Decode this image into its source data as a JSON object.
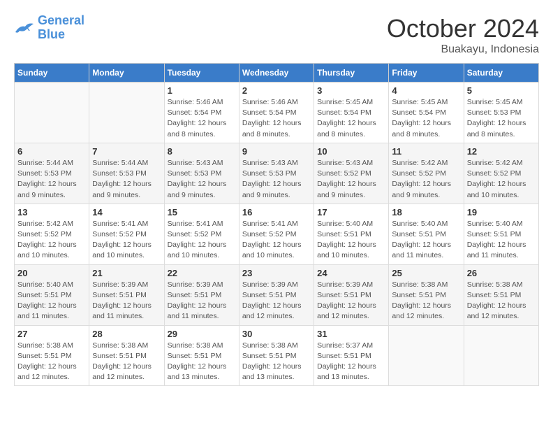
{
  "header": {
    "logo_line1": "General",
    "logo_line2": "Blue",
    "month_year": "October 2024",
    "location": "Buakayu, Indonesia"
  },
  "weekdays": [
    "Sunday",
    "Monday",
    "Tuesday",
    "Wednesday",
    "Thursday",
    "Friday",
    "Saturday"
  ],
  "weeks": [
    [
      {
        "day": "",
        "info": ""
      },
      {
        "day": "",
        "info": ""
      },
      {
        "day": "1",
        "info": "Sunrise: 5:46 AM\nSunset: 5:54 PM\nDaylight: 12 hours and 8 minutes."
      },
      {
        "day": "2",
        "info": "Sunrise: 5:46 AM\nSunset: 5:54 PM\nDaylight: 12 hours and 8 minutes."
      },
      {
        "day": "3",
        "info": "Sunrise: 5:45 AM\nSunset: 5:54 PM\nDaylight: 12 hours and 8 minutes."
      },
      {
        "day": "4",
        "info": "Sunrise: 5:45 AM\nSunset: 5:54 PM\nDaylight: 12 hours and 8 minutes."
      },
      {
        "day": "5",
        "info": "Sunrise: 5:45 AM\nSunset: 5:53 PM\nDaylight: 12 hours and 8 minutes."
      }
    ],
    [
      {
        "day": "6",
        "info": "Sunrise: 5:44 AM\nSunset: 5:53 PM\nDaylight: 12 hours and 9 minutes."
      },
      {
        "day": "7",
        "info": "Sunrise: 5:44 AM\nSunset: 5:53 PM\nDaylight: 12 hours and 9 minutes."
      },
      {
        "day": "8",
        "info": "Sunrise: 5:43 AM\nSunset: 5:53 PM\nDaylight: 12 hours and 9 minutes."
      },
      {
        "day": "9",
        "info": "Sunrise: 5:43 AM\nSunset: 5:53 PM\nDaylight: 12 hours and 9 minutes."
      },
      {
        "day": "10",
        "info": "Sunrise: 5:43 AM\nSunset: 5:52 PM\nDaylight: 12 hours and 9 minutes."
      },
      {
        "day": "11",
        "info": "Sunrise: 5:42 AM\nSunset: 5:52 PM\nDaylight: 12 hours and 9 minutes."
      },
      {
        "day": "12",
        "info": "Sunrise: 5:42 AM\nSunset: 5:52 PM\nDaylight: 12 hours and 10 minutes."
      }
    ],
    [
      {
        "day": "13",
        "info": "Sunrise: 5:42 AM\nSunset: 5:52 PM\nDaylight: 12 hours and 10 minutes."
      },
      {
        "day": "14",
        "info": "Sunrise: 5:41 AM\nSunset: 5:52 PM\nDaylight: 12 hours and 10 minutes."
      },
      {
        "day": "15",
        "info": "Sunrise: 5:41 AM\nSunset: 5:52 PM\nDaylight: 12 hours and 10 minutes."
      },
      {
        "day": "16",
        "info": "Sunrise: 5:41 AM\nSunset: 5:52 PM\nDaylight: 12 hours and 10 minutes."
      },
      {
        "day": "17",
        "info": "Sunrise: 5:40 AM\nSunset: 5:51 PM\nDaylight: 12 hours and 10 minutes."
      },
      {
        "day": "18",
        "info": "Sunrise: 5:40 AM\nSunset: 5:51 PM\nDaylight: 12 hours and 11 minutes."
      },
      {
        "day": "19",
        "info": "Sunrise: 5:40 AM\nSunset: 5:51 PM\nDaylight: 12 hours and 11 minutes."
      }
    ],
    [
      {
        "day": "20",
        "info": "Sunrise: 5:40 AM\nSunset: 5:51 PM\nDaylight: 12 hours and 11 minutes."
      },
      {
        "day": "21",
        "info": "Sunrise: 5:39 AM\nSunset: 5:51 PM\nDaylight: 12 hours and 11 minutes."
      },
      {
        "day": "22",
        "info": "Sunrise: 5:39 AM\nSunset: 5:51 PM\nDaylight: 12 hours and 11 minutes."
      },
      {
        "day": "23",
        "info": "Sunrise: 5:39 AM\nSunset: 5:51 PM\nDaylight: 12 hours and 12 minutes."
      },
      {
        "day": "24",
        "info": "Sunrise: 5:39 AM\nSunset: 5:51 PM\nDaylight: 12 hours and 12 minutes."
      },
      {
        "day": "25",
        "info": "Sunrise: 5:38 AM\nSunset: 5:51 PM\nDaylight: 12 hours and 12 minutes."
      },
      {
        "day": "26",
        "info": "Sunrise: 5:38 AM\nSunset: 5:51 PM\nDaylight: 12 hours and 12 minutes."
      }
    ],
    [
      {
        "day": "27",
        "info": "Sunrise: 5:38 AM\nSunset: 5:51 PM\nDaylight: 12 hours and 12 minutes."
      },
      {
        "day": "28",
        "info": "Sunrise: 5:38 AM\nSunset: 5:51 PM\nDaylight: 12 hours and 12 minutes."
      },
      {
        "day": "29",
        "info": "Sunrise: 5:38 AM\nSunset: 5:51 PM\nDaylight: 12 hours and 13 minutes."
      },
      {
        "day": "30",
        "info": "Sunrise: 5:38 AM\nSunset: 5:51 PM\nDaylight: 12 hours and 13 minutes."
      },
      {
        "day": "31",
        "info": "Sunrise: 5:37 AM\nSunset: 5:51 PM\nDaylight: 12 hours and 13 minutes."
      },
      {
        "day": "",
        "info": ""
      },
      {
        "day": "",
        "info": ""
      }
    ]
  ]
}
